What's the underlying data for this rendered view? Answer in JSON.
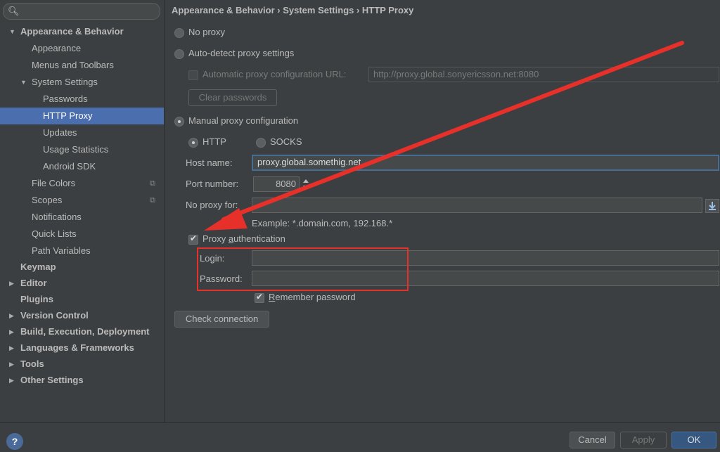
{
  "sidebar": {
    "search_icon": "magnifier-icon",
    "items": [
      {
        "label": "Appearance & Behavior",
        "level": 0,
        "expanded": true,
        "bold": true
      },
      {
        "label": "Appearance",
        "level": 1
      },
      {
        "label": "Menus and Toolbars",
        "level": 1
      },
      {
        "label": "System Settings",
        "level": 1,
        "expanded": true
      },
      {
        "label": "Passwords",
        "level": 2
      },
      {
        "label": "HTTP Proxy",
        "level": 2,
        "selected": true
      },
      {
        "label": "Updates",
        "level": 2
      },
      {
        "label": "Usage Statistics",
        "level": 2
      },
      {
        "label": "Android SDK",
        "level": 2
      },
      {
        "label": "File Colors",
        "level": 1,
        "copy": true
      },
      {
        "label": "Scopes",
        "level": 1,
        "copy": true
      },
      {
        "label": "Notifications",
        "level": 1
      },
      {
        "label": "Quick Lists",
        "level": 1
      },
      {
        "label": "Path Variables",
        "level": 1
      },
      {
        "label": "Keymap",
        "level": 0,
        "bold": true
      },
      {
        "label": "Editor",
        "level": 0,
        "bold": true,
        "collapsed": true
      },
      {
        "label": "Plugins",
        "level": 0,
        "bold": true
      },
      {
        "label": "Version Control",
        "level": 0,
        "bold": true,
        "collapsed": true
      },
      {
        "label": "Build, Execution, Deployment",
        "level": 0,
        "bold": true,
        "collapsed": true
      },
      {
        "label": "Languages & Frameworks",
        "level": 0,
        "bold": true,
        "collapsed": true
      },
      {
        "label": "Tools",
        "level": 0,
        "bold": true,
        "collapsed": true
      },
      {
        "label": "Other Settings",
        "level": 0,
        "bold": true,
        "collapsed": true
      }
    ]
  },
  "breadcrumb": "Appearance & Behavior › System Settings › HTTP Proxy",
  "proxy": {
    "no_proxy": "No proxy",
    "auto_detect": "Auto-detect proxy settings",
    "auto_url_label": "Automatic proxy configuration URL:",
    "auto_url_value": "http://proxy.global.sonyericsson.net:8080",
    "clear_passwords": "Clear passwords",
    "manual": "Manual proxy configuration",
    "http": "HTTP",
    "socks": "SOCKS",
    "host_label": "Host name:",
    "host_value": "proxy.global.somethig.net",
    "port_label": "Port number:",
    "port_value": "8080",
    "noproxy_label": "No proxy for:",
    "noproxy_value": "",
    "example": "Example: *.domain.com, 192.168.*",
    "auth_pre": "Proxy ",
    "auth_ul": "a",
    "auth_post": "uthentication",
    "login_label": "Login:",
    "password_label": "Password:",
    "remember_ul": "R",
    "remember_post": "emember password",
    "check_connection": "Check connection"
  },
  "footer": {
    "help": "?",
    "cancel": "Cancel",
    "apply": "Apply",
    "ok": "OK"
  },
  "colors": {
    "annotation": "#e8302a",
    "selection": "#4b6eaf"
  }
}
